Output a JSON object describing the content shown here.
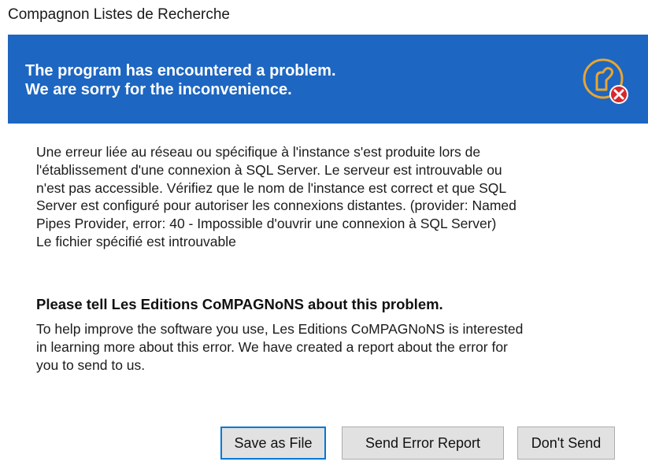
{
  "window": {
    "title": "Compagnon Listes de Recherche"
  },
  "banner": {
    "line1": "The program has encountered a problem.",
    "line2": "We are sorry for the inconvenience.",
    "icon": "error-report-icon",
    "background_color": "#1d66c2",
    "badge_color": "#d9262a",
    "icon_color": "#e8a531"
  },
  "error_message": {
    "lines": [
      "Une erreur liée au réseau ou spécifique à l'instance s'est produite lors de",
      "l'établissement d'une connexion à SQL Server. Le serveur est introuvable ou",
      "n'est pas accessible. Vérifiez que le nom de l'instance est correct et que SQL",
      "Server est configuré pour autoriser les connexions distantes. (provider: Named",
      "Pipes Provider, error: 40 - Impossible d'ouvrir une connexion à SQL Server)",
      "Le fichier spécifié est introuvable"
    ]
  },
  "request": {
    "title": "Please tell Les Editions CoMPAGNoNS about this problem.",
    "lines": [
      "To help improve the software you use, Les Editions CoMPAGNoNS is interested",
      "in learning more about this error. We have created a report about the error for",
      "you to send to us."
    ]
  },
  "buttons": {
    "save_label": "Save as File",
    "send_label": "Send Error Report",
    "dont_send_label": "Don't Send"
  }
}
